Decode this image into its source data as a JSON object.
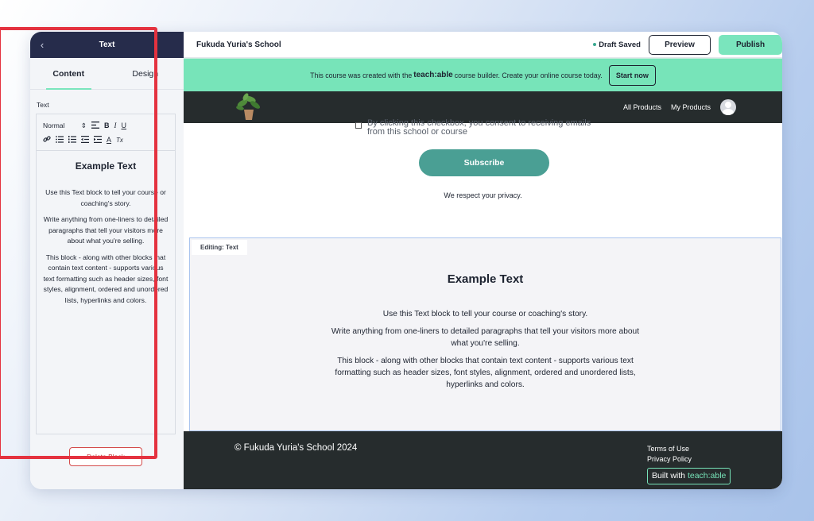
{
  "left_header": {
    "back": "‹",
    "title": "Text"
  },
  "topbar": {
    "school_name": "Fukuda Yuria's School",
    "status": "Draft Saved",
    "preview_label": "Preview",
    "publish_label": "Publish"
  },
  "panel": {
    "tabs": [
      {
        "label": "Content",
        "active": true
      },
      {
        "label": "Design",
        "active": false
      }
    ],
    "field_label": "Text",
    "toolbar": {
      "style_select": "Normal",
      "select_arrows": "⇕",
      "bold": "B",
      "italic": "I",
      "underline": "U",
      "color": "A",
      "clear": "Tx"
    },
    "content": {
      "heading": "Example Text",
      "p1": "Use this Text block to tell your course or coaching's story.",
      "p2": "Write anything from one-liners to detailed paragraphs that tell your visitors more about what you're selling.",
      "p3": "This block - along with other blocks that contain text content - supports various text formatting such as header sizes, font styles, alignment, ordered and unordered lists, hyperlinks and colors."
    },
    "delete_label": "Delete Block"
  },
  "banner": {
    "text_before": "This course was created with the",
    "brand": "teach:able",
    "text_after": "course builder. Create your online course today.",
    "cta": "Start now"
  },
  "site_nav": {
    "links": [
      "All Products",
      "My Products"
    ]
  },
  "subscribe": {
    "consent": "By clicking this checkbox, you consent to receiving emails from this school or course",
    "button": "Subscribe",
    "privacy": "We respect your privacy."
  },
  "editing_block": {
    "tag": "Editing: Text",
    "heading": "Example Text",
    "p1": "Use this Text block to tell your course or coaching's story.",
    "p2": "Write anything from one-liners to detailed paragraphs that tell your visitors more about what you're selling.",
    "p3": "This block - along with other blocks that contain text content - supports various text formatting such as header sizes, font styles, alignment, ordered and unordered lists, hyperlinks and colors."
  },
  "footer": {
    "copyright": "© Fukuda Yuria's School 2024",
    "terms": "Terms of Use",
    "privacy": "Privacy Policy",
    "built_prefix": "Built with",
    "built_brand": "teach:able"
  },
  "colors": {
    "accent_green": "#77e4b9",
    "dark": "#262c2d",
    "navy": "#262c4b",
    "highlight_red": "#e4323f",
    "subscribe_teal": "#4a9f94"
  }
}
